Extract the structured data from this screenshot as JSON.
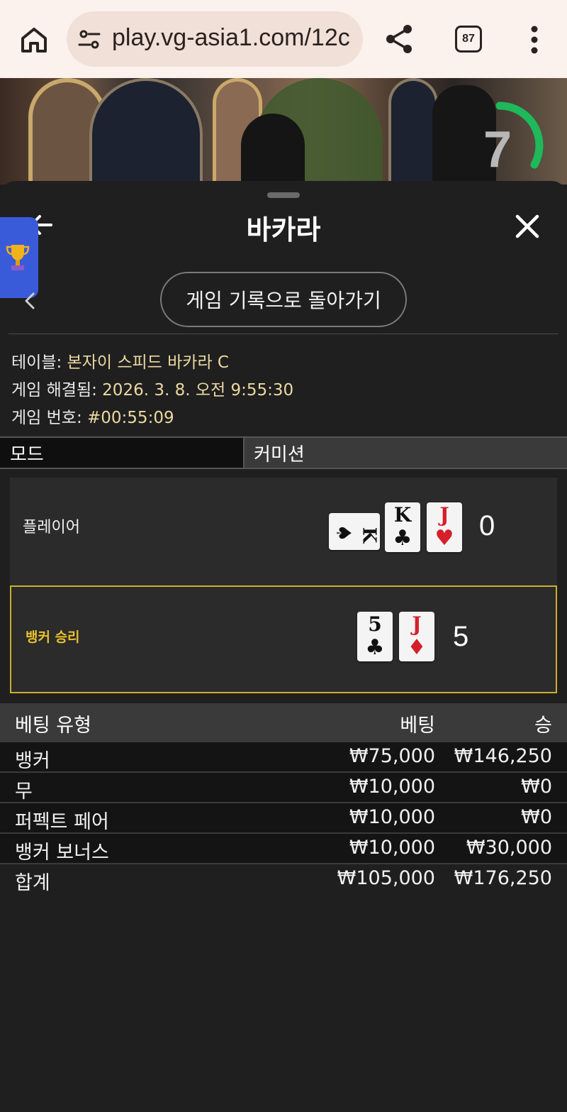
{
  "browser": {
    "url": "play.vg-asia1.com/12c",
    "tab_count": "87"
  },
  "video": {
    "timer": "7",
    "timer_fraction": 0.33
  },
  "sheet": {
    "title": "바카라",
    "history_button": "게임 기록으로 돌아가기"
  },
  "info": {
    "table_label": "테이블: ",
    "table_value": "본자이 스피드 바카라 C",
    "resolved_label": "게임 해결됨: ",
    "resolved_value": "2026. 3. 8. 오전 9:55:30",
    "game_no_label": "게임 번호: ",
    "game_no_value": "#00:55:09"
  },
  "mode": {
    "label": "모드",
    "value": "커미션"
  },
  "player": {
    "label": "플레이어",
    "score": "0",
    "cards": [
      {
        "rank": "K",
        "suit": "♠",
        "color": "black",
        "sideways": true
      },
      {
        "rank": "K",
        "suit": "♣",
        "color": "black"
      },
      {
        "rank": "J",
        "suit": "♥",
        "color": "red"
      }
    ]
  },
  "banker": {
    "label": "뱅커 승리",
    "score": "5",
    "cards": [
      {
        "rank": "5",
        "suit": "♣",
        "color": "black"
      },
      {
        "rank": "J",
        "suit": "♦",
        "color": "red"
      }
    ]
  },
  "bets": {
    "headers": {
      "type": "베팅 유형",
      "bet": "베팅",
      "win": "승"
    },
    "rows": [
      {
        "type": "뱅커",
        "bet": "₩75,000",
        "win": "₩146,250"
      },
      {
        "type": "무",
        "bet": "₩10,000",
        "win": "₩0"
      },
      {
        "type": "퍼펙트 페어",
        "bet": "₩10,000",
        "win": "₩0"
      },
      {
        "type": "뱅커 보너스",
        "bet": "₩10,000",
        "win": "₩30,000"
      }
    ],
    "total": {
      "type": "합계",
      "bet": "₩105,000",
      "win": "₩176,250"
    }
  },
  "colors": {
    "accent_gold": "#e8c12c",
    "info_value": "#ecd9a2",
    "timer_green": "#1fb85a",
    "trophy_tab": "#3a5bd9"
  }
}
